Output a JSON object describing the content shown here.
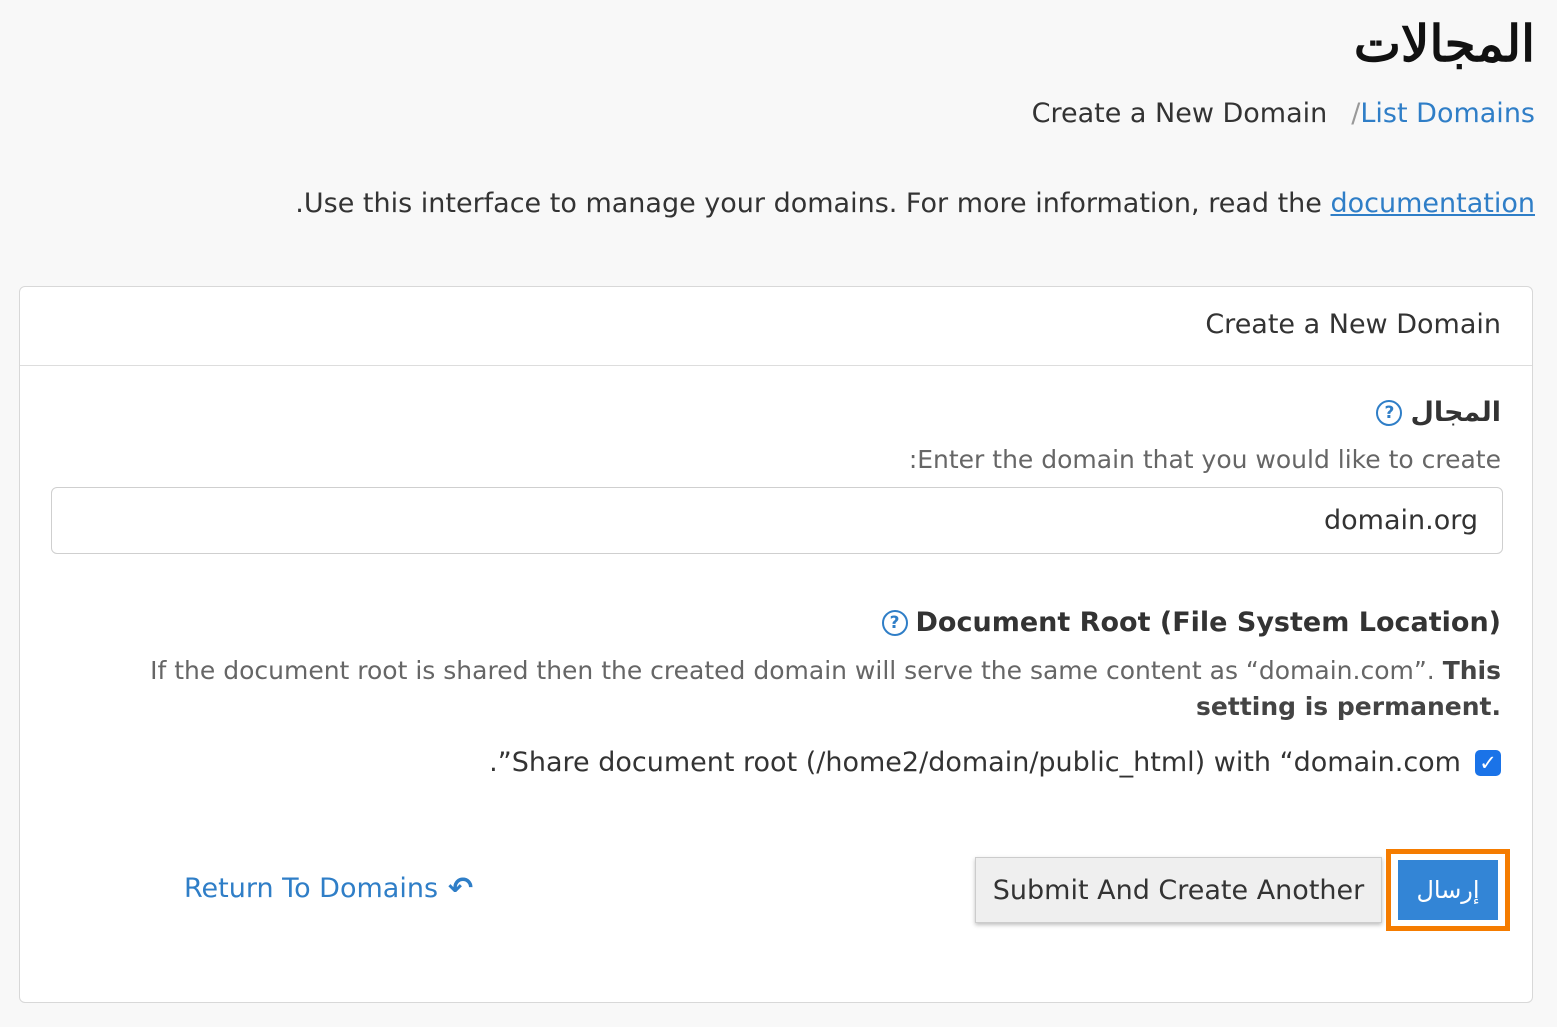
{
  "page": {
    "title": "المجالات",
    "intro_text": ".Use this interface to manage your domains. For more information, read the ",
    "intro_link": "documentation"
  },
  "breadcrumb": {
    "current": "Create a New Domain",
    "separator": "/",
    "parent": "List Domains"
  },
  "panel": {
    "title": "Create a New Domain",
    "domain_field": {
      "label": "المجال",
      "hint": ":Enter the domain that you would like to create",
      "value": "domain.org",
      "help_icon": "question-circle-icon"
    },
    "docroot_field": {
      "label": "Document Root (File System Location)",
      "description": "If the document root is shared then the created domain will serve the same content as “domain.com”. ",
      "description_bold": "This setting is permanent.",
      "help_icon": "question-circle-icon",
      "share_label": ".”Share document root (/home2/domain/public_html) with “domain.com",
      "share_checked": true
    },
    "buttons": {
      "submit_another": "Submit And Create Another",
      "submit": "إرسال",
      "return": "Return To Domains"
    }
  },
  "colors": {
    "link": "#2f7ec7",
    "primary_button": "#3385d6",
    "highlight": "#f57c00",
    "checkbox": "#1a73e8"
  }
}
